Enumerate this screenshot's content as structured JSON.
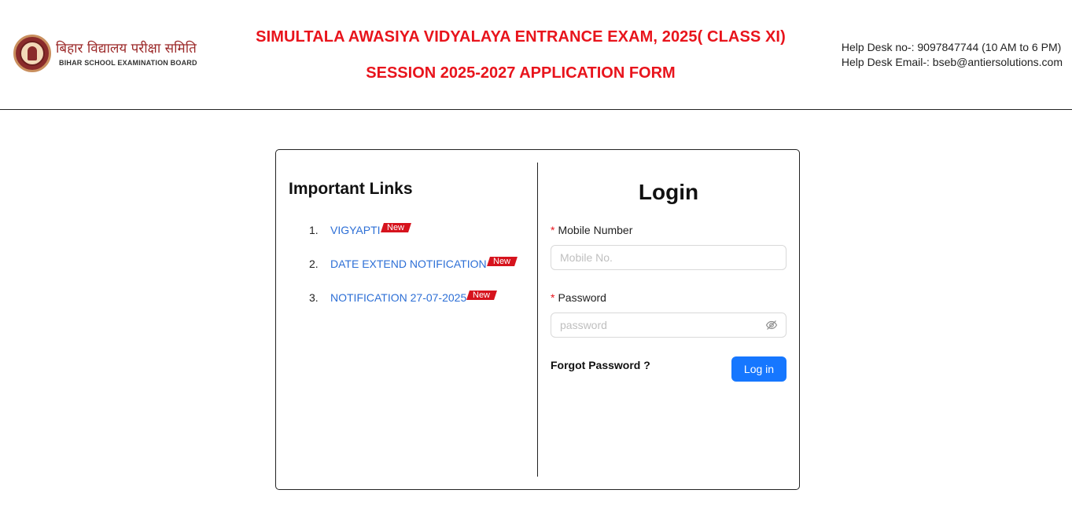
{
  "header": {
    "logo_hindi": "बिहार विद्यालय परीक्षा समिति",
    "logo_english": "BIHAR SCHOOL EXAMINATION BOARD",
    "title_line1": "SIMULTALA AWASIYA VIDYALAYA ENTRANCE EXAM, 2025( CLASS XI)",
    "title_line2": "SESSION 2025-2027 APPLICATION FORM",
    "help_phone": "Help Desk no-: 9097847744 (10 AM to 6 PM)",
    "help_email": "Help Desk Email-: bseb@antiersolutions.com"
  },
  "links": {
    "title": "Important Links",
    "items": [
      {
        "num": "1.",
        "label": "VIGYAPTI",
        "badge": "New"
      },
      {
        "num": "2.",
        "label": "DATE EXTEND NOTIFICATION",
        "badge": "New"
      },
      {
        "num": "3.",
        "label": "NOTIFICATION 27-07-2025",
        "badge": "New"
      }
    ]
  },
  "login": {
    "title": "Login",
    "required_mark": "*",
    "mobile_label": "Mobile Number",
    "mobile_placeholder": "Mobile No.",
    "password_label": "Password",
    "password_placeholder": "password",
    "forgot_label": "Forgot Password ?",
    "submit_label": "Log in"
  },
  "colors": {
    "title_red": "#e8141c",
    "link_blue": "#2d6fd6",
    "button_blue": "#1677ff",
    "badge_red": "#d6131d"
  },
  "icons": {
    "logo": "bseb-seal-icon",
    "password_toggle": "eye-off-icon"
  }
}
